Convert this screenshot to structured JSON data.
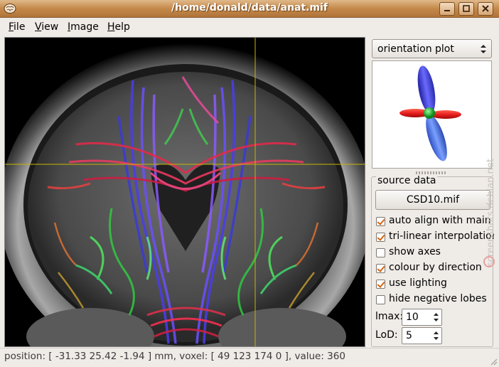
{
  "window": {
    "title": "/home/donald/data/anat.mif",
    "app_icon": "brain-icon",
    "controls": [
      "minimize-icon",
      "maximize-icon",
      "close-icon"
    ]
  },
  "menu": [
    {
      "label": "File",
      "mnemonic": "F",
      "rest": "ile"
    },
    {
      "label": "View",
      "mnemonic": "V",
      "rest": "iew"
    },
    {
      "label": "Image",
      "mnemonic": "I",
      "rest": "mage"
    },
    {
      "label": "Help",
      "mnemonic": "H",
      "rest": "elp"
    }
  ],
  "panel": {
    "plot_mode": "orientation plot",
    "source_group_title": "source data",
    "source_file": "CSD10.mif",
    "options": [
      {
        "label": "auto align with main view",
        "checked": true
      },
      {
        "label": "tri-linear interpolation",
        "checked": true
      },
      {
        "label": "show axes",
        "checked": false
      },
      {
        "label": "colour by direction",
        "checked": true
      },
      {
        "label": "use lighting",
        "checked": true
      },
      {
        "label": "hide negative lobes",
        "checked": false
      }
    ],
    "lmax_label": "lmax:",
    "lmax_value": "10",
    "lod_label": "LoD:",
    "lod_value": "5"
  },
  "status": "position: [ -31.33 25.42 -1.94 ] mm, voxel: [ 49 123 174 0 ], value: 360",
  "watermark": "screenshots.debian.net",
  "colors": {
    "titlebar": "#c4894a",
    "accent_check": "#d4640f",
    "crosshair": "#c8b400"
  }
}
